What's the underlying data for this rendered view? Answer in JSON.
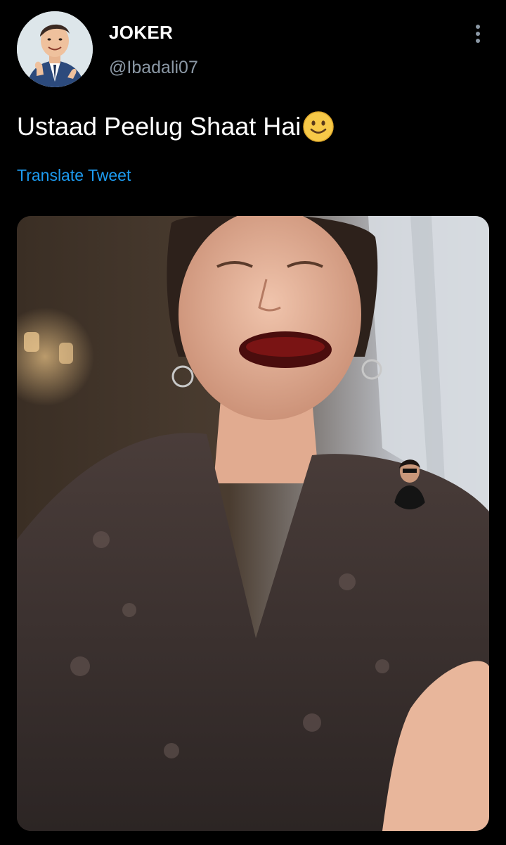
{
  "tweet": {
    "author": {
      "display_name": "JOKER",
      "handle": "@Ibadali07",
      "avatar_icon": "cartoon-man-suit-thumbs-up-avatar"
    },
    "text": "Ustaad Peelug Shaat Hai",
    "emoji_icon": "slightly-smiling-face-icon",
    "translate_label": "Translate Tweet",
    "menu_icon": "more-vertical-icon",
    "media": {
      "kind": "photo",
      "overlay_icon": "small-person-avatar-sticker"
    }
  },
  "colors": {
    "background": "#000000",
    "primary_text": "#ffffff",
    "secondary_text": "#8b98a5",
    "link": "#1d9bf0",
    "emoji": "#f7c948"
  }
}
